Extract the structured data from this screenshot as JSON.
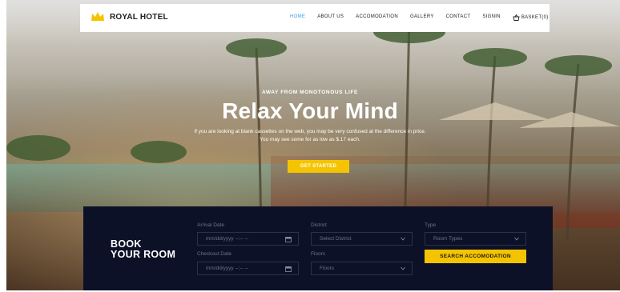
{
  "brand": {
    "name": "ROYAL HOTEL",
    "logo_icon": "crown-icon",
    "accent": "#f5c400"
  },
  "nav": {
    "items": [
      {
        "label": "HOME",
        "active": true
      },
      {
        "label": "ABOUT US",
        "active": false
      },
      {
        "label": "ACCOMODATION",
        "active": false
      },
      {
        "label": "GALLERY",
        "active": false
      },
      {
        "label": "CONTACT",
        "active": false
      },
      {
        "label": "SIGNIN",
        "active": false
      }
    ],
    "basket_label": "BASKET(0)",
    "basket_icon": "basket-icon",
    "active_color": "#3aa0e0"
  },
  "hero": {
    "eyebrow": "AWAY FROM MONOTONOUS LIFE",
    "headline": "Relax Your Mind",
    "description": "If you are looking at blank cassettes on the web, you may be very confused at the difference in price. You may see some for as low as $.17 each.",
    "cta_label": "GET STARTED"
  },
  "booking": {
    "title_line1": "BOOK",
    "title_line2": "YOUR ROOM",
    "arrival_label": "Arrival Date",
    "arrival_placeholder": "mm/dd/yyyy --:-- --",
    "checkout_label": "Checkout Date",
    "checkout_placeholder": "mm/dd/yyyy --:-- --",
    "district_label": "District",
    "district_value": "Select District",
    "floors_label": "Floors",
    "floors_value": "Floors",
    "type_label": "Type",
    "type_value": "Room Types",
    "search_label": "SEARCH ACCOMODATION",
    "panel_color": "#0d1128"
  }
}
